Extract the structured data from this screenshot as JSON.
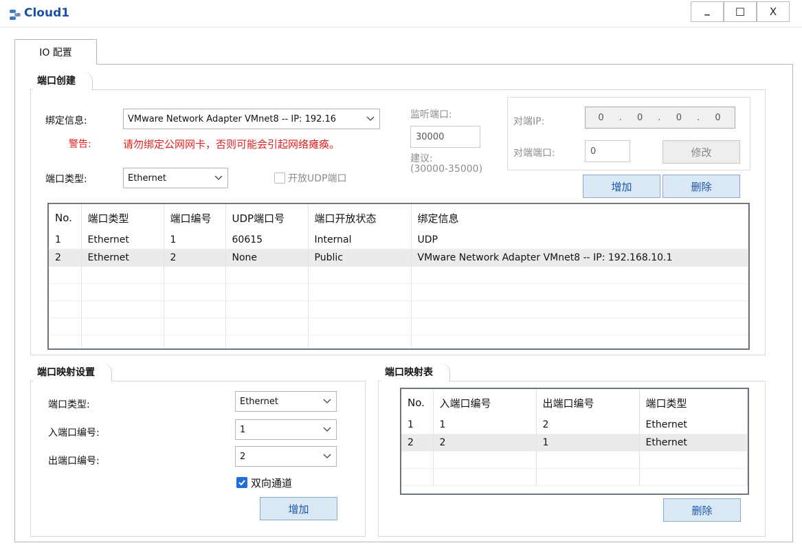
{
  "window": {
    "title": "Cloud1",
    "min_label": "_",
    "max_label": "☐",
    "close_label": "X"
  },
  "tabs": [
    {
      "label": "IO 配置",
      "active": true
    }
  ],
  "port_creation": {
    "group_label": "端口创建",
    "bind_label": "绑定信息:",
    "bind_value": "VMware Network Adapter VMnet8 -- IP: 192.16",
    "warning_label": "警告:",
    "warning_text": "请勿绑定公网网卡，否则可能会引起网络瘫痪。",
    "port_type_label": "端口类型:",
    "port_type_value": "Ethernet",
    "udp_checkbox_label": "开放UDP端口",
    "udp_checked": false,
    "listen_label": "监听端口:",
    "listen_value": "30000",
    "suggest_label": "建议:",
    "suggest_range": "(30000-35000)",
    "peer_ip_label": "对端IP:",
    "peer_ip_value": "0 . 0 . 0 . 0",
    "peer_port_label": "对端端口:",
    "peer_port_value": "0",
    "modify_button": "修改",
    "add_button": "增加",
    "delete_button": "删除"
  },
  "port_table": {
    "columns": [
      "No.",
      "端口类型",
      "端口编号",
      "UDP端口号",
      "端口开放状态",
      "绑定信息"
    ],
    "rows": [
      [
        "1",
        "Ethernet",
        "1",
        "60615",
        "Internal",
        "UDP"
      ],
      [
        "2",
        "Ethernet",
        "2",
        "None",
        "Public",
        "VMware Network Adapter VMnet8 -- IP: 192.168.10.1"
      ]
    ]
  },
  "port_mapping_settings": {
    "group_label": "端口映射设置",
    "port_type_label": "端口类型:",
    "port_type_value": "Ethernet",
    "in_port_label": "入端口编号:",
    "in_port_value": "1",
    "out_port_label": "出端口编号:",
    "out_port_value": "2",
    "bidirectional_label": "双向通道",
    "bidirectional_checked": true,
    "add_button": "增加"
  },
  "port_mapping_table": {
    "group_label": "端口映射表",
    "columns": [
      "No.",
      "入端口编号",
      "出端口编号",
      "端口类型"
    ],
    "rows": [
      [
        "1",
        "1",
        "2",
        "Ethernet"
      ],
      [
        "2",
        "2",
        "1",
        "Ethernet"
      ]
    ],
    "delete_button": "删除"
  },
  "colors": {
    "title": "#1c4fa8",
    "warning": "#e02020",
    "button_text": "#1a55a8",
    "button_bg": "#dbe9f7",
    "checkbox_on": "#1f6fd6"
  },
  "icons": {
    "app": "cloud-app-icon",
    "dropdown": "chevron-down-icon",
    "check": "checkmark-icon"
  }
}
